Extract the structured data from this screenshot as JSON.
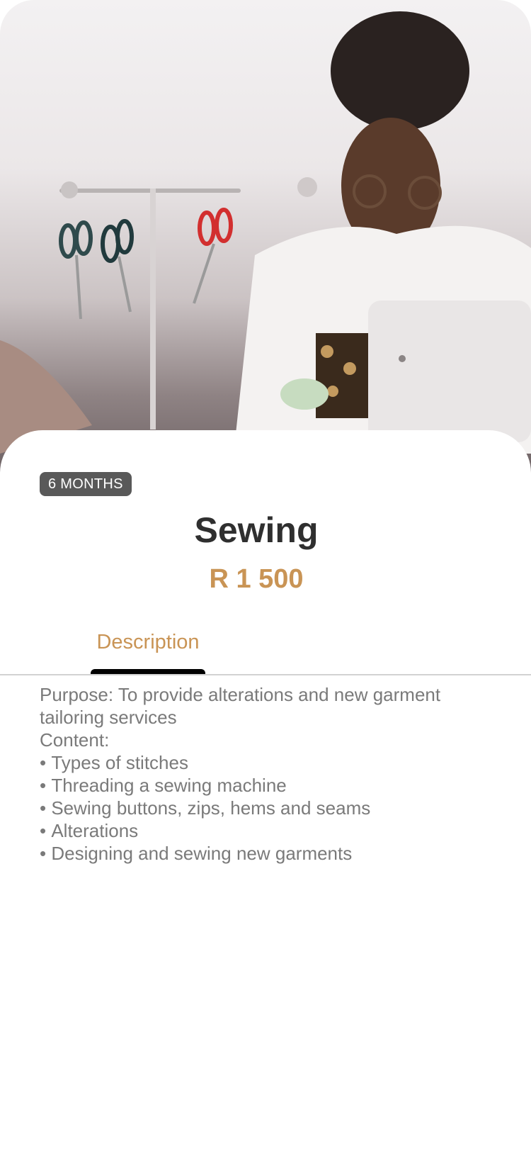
{
  "hero": {
    "image": "seamstress-at-sewing-machine-photo"
  },
  "course": {
    "duration_badge": "6 MONTHS",
    "title": "Sewing",
    "price": "R 1 500"
  },
  "tabs": {
    "active_label": "Description"
  },
  "description": {
    "purpose_line": "Purpose: To provide alterations and new garment tailoring services",
    "content_heading": "Content:",
    "items": [
      "Types of stitches",
      "Threading a sewing machine",
      "Sewing buttons, zips, hems and seams",
      "Alterations",
      "Designing and sewing new garments"
    ]
  },
  "colors": {
    "accent": "#c99455",
    "title": "#2f2f2f",
    "badge_background": "#595959",
    "body_text": "#7a7a7a",
    "tab_indicator": "#000000"
  }
}
